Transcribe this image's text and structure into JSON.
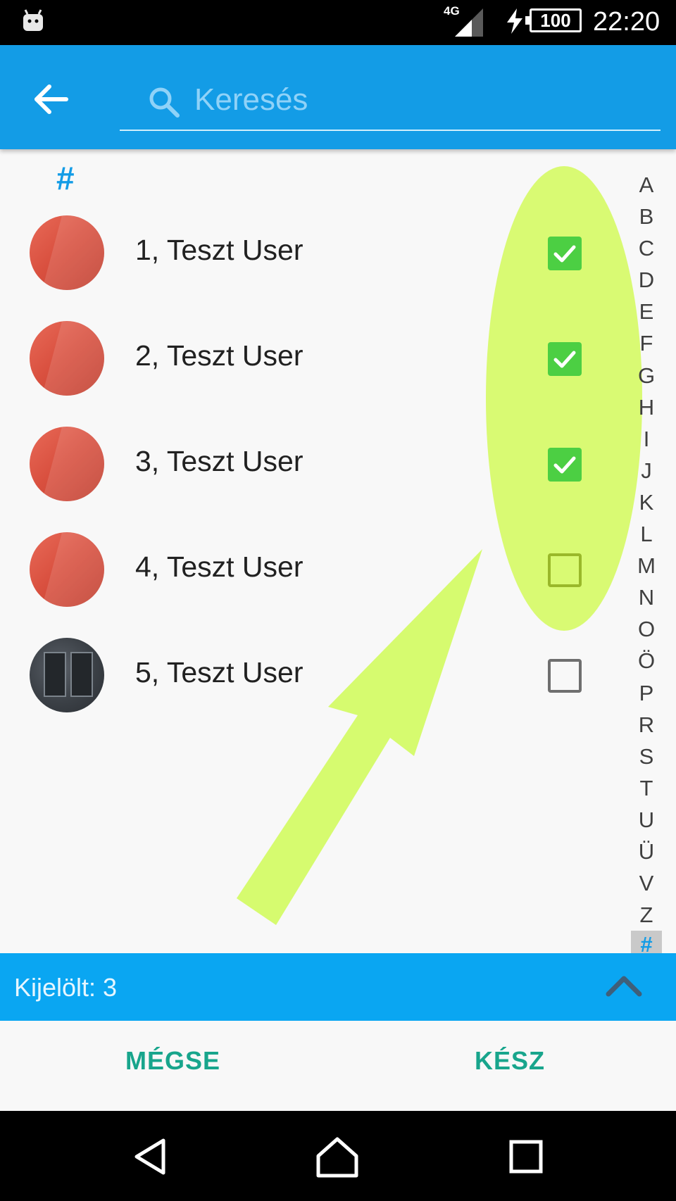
{
  "status_bar": {
    "network": "4G",
    "battery": "100",
    "time": "22:20"
  },
  "search": {
    "placeholder": "Keresés",
    "value": ""
  },
  "list": {
    "section_header": "#",
    "contacts": [
      {
        "name": "1, Teszt User",
        "checked": true,
        "avatar": "red-avatar"
      },
      {
        "name": "2, Teszt User",
        "checked": true,
        "avatar": "red-avatar"
      },
      {
        "name": "3, Teszt User",
        "checked": true,
        "avatar": "red-avatar"
      },
      {
        "name": "4, Teszt User",
        "checked": false,
        "avatar": "red-avatar"
      },
      {
        "name": "5, Teszt User",
        "checked": false,
        "avatar": "photo-avatar"
      }
    ]
  },
  "alphabet_index": [
    "A",
    "B",
    "C",
    "D",
    "E",
    "F",
    "G",
    "H",
    "I",
    "J",
    "K",
    "L",
    "M",
    "N",
    "O",
    "Ö",
    "P",
    "R",
    "S",
    "T",
    "U",
    "Ü",
    "V",
    "Z",
    "#"
  ],
  "alphabet_active": "#",
  "selection_bar": {
    "text": "Kijelölt: 3"
  },
  "actions": {
    "cancel_label": "MÉGSE",
    "done_label": "KÉSZ"
  },
  "colors": {
    "app_bar": "#139ce6",
    "selection_bar": "#0aa6f2",
    "checkbox_checked": "#4ccf43",
    "button_text": "#18a58c",
    "highlight": "#d4fa5c"
  }
}
